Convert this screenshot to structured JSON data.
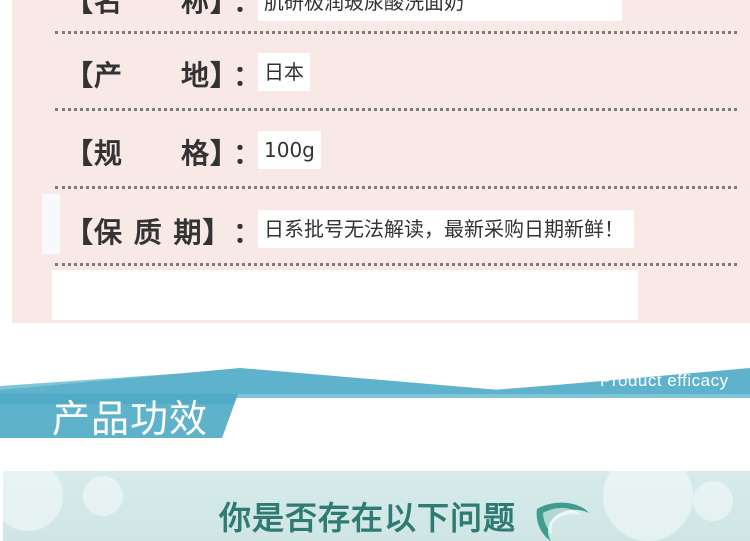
{
  "product_info": {
    "rows": [
      {
        "label": "【名　　称】",
        "colon": "：",
        "value": "肌研极润玻尿酸洗面奶"
      },
      {
        "label": "【产　　地】",
        "colon": "：",
        "value": "日本"
      },
      {
        "label": "【规　　格】",
        "colon": "：",
        "value": "100g"
      },
      {
        "label": "【保 质 期】",
        "colon": "：",
        "value": "日系批号无法解读，最新采购日期新鲜！"
      }
    ]
  },
  "section": {
    "title": "产品功效",
    "subtitle": "Product efficacy"
  },
  "banner": {
    "title": "你是否存在以下问题"
  },
  "colors": {
    "panel_bg": "#f8e8e6",
    "header_blue": "#5fb2cc",
    "banner_teal": "#2f7a72"
  }
}
